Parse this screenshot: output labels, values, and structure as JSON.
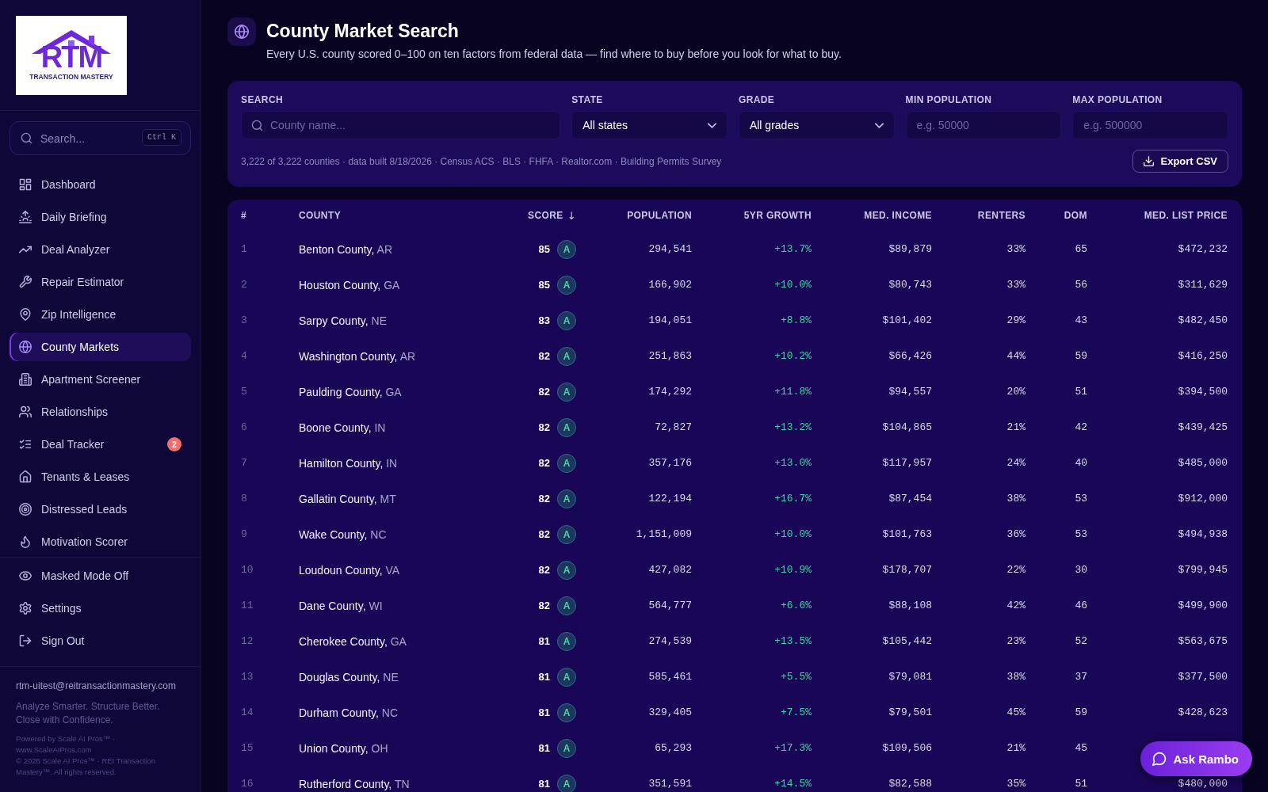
{
  "sidebar": {
    "logo": {
      "mark": "RTM",
      "name": "TRANSACTION MASTERY"
    },
    "search": {
      "placeholder": "Search...",
      "shortcut": "Ctrl K"
    },
    "nav": [
      {
        "label": "Dashboard",
        "selected": false
      },
      {
        "label": "Daily Briefing",
        "selected": false
      },
      {
        "label": "Deal Analyzer",
        "selected": false
      },
      {
        "label": "Repair Estimator",
        "selected": false
      },
      {
        "label": "Zip Intelligence",
        "selected": false
      },
      {
        "label": "County Markets",
        "selected": true
      },
      {
        "label": "Apartment Screener",
        "selected": false
      },
      {
        "label": "Relationships",
        "selected": false
      },
      {
        "label": "Deal Tracker",
        "selected": false,
        "badge": "2"
      },
      {
        "label": "Tenants & Leases",
        "selected": false
      },
      {
        "label": "Distressed Leads",
        "selected": false
      },
      {
        "label": "Motivation Scorer",
        "selected": false
      }
    ],
    "bottom_items": [
      {
        "label": "Masked Mode Off"
      },
      {
        "label": "Settings"
      },
      {
        "label": "Sign Out"
      }
    ],
    "footer": {
      "email": "rtm-uitest@reitransactionmastery.com",
      "tagline": "Analyze Smarter. Structure Better. Close with Confidence.",
      "powered": "Powered by Scale AI Pros™ · www.ScaleAIPros.com",
      "copyright": "© 2026 Scale AI Pros™ · REI Transaction Mastery™. All rights reserved."
    }
  },
  "header": {
    "title": "County Market Search",
    "subtitle": "Every U.S. county scored 0–100 on ten factors from federal data — find where to buy before you look for what to buy."
  },
  "filters": {
    "fields": [
      {
        "kind": "search",
        "label": "SEARCH",
        "placeholder": "County name..."
      },
      {
        "kind": "select",
        "label": "STATE",
        "value": "All states"
      },
      {
        "kind": "select",
        "label": "GRADE",
        "value": "All grades"
      },
      {
        "kind": "number",
        "label": "MIN POPULATION",
        "placeholder": "e.g. 50000"
      },
      {
        "kind": "number",
        "label": "MAX POPULATION",
        "placeholder": "e.g. 500000"
      }
    ],
    "summary": "3,222 of 3,222 counties · data built 8/18/2026 · Census ACS · BLS · FHFA · Realtor.com · Building Permits Survey",
    "export_button": "Export CSV"
  },
  "table": {
    "columns": [
      {
        "label": "#"
      },
      {
        "label": "COUNTY"
      },
      {
        "label": "SCORE",
        "sort_arrow": "↓"
      },
      {
        "label": "POPULATION"
      },
      {
        "label": "5YR GROWTH"
      },
      {
        "label": "MED. INCOME"
      },
      {
        "label": "RENTERS"
      },
      {
        "label": "DOM"
      },
      {
        "label": "MED. LIST PRICE"
      }
    ],
    "rows": [
      {
        "rank": "1",
        "county": "Benton County,",
        "state": "AR",
        "score": "85",
        "grade": "A",
        "population": "294,541",
        "growth": "+13.7%",
        "income": "$89,879",
        "renters": "33%",
        "dom": "65",
        "price": "$472,232"
      },
      {
        "rank": "2",
        "county": "Houston County,",
        "state": "GA",
        "score": "85",
        "grade": "A",
        "population": "166,902",
        "growth": "+10.0%",
        "income": "$80,743",
        "renters": "33%",
        "dom": "56",
        "price": "$311,629"
      },
      {
        "rank": "3",
        "county": "Sarpy County,",
        "state": "NE",
        "score": "83",
        "grade": "A",
        "population": "194,051",
        "growth": "+8.8%",
        "income": "$101,402",
        "renters": "29%",
        "dom": "43",
        "price": "$482,450"
      },
      {
        "rank": "4",
        "county": "Washington County,",
        "state": "AR",
        "score": "82",
        "grade": "A",
        "population": "251,863",
        "growth": "+10.2%",
        "income": "$66,426",
        "renters": "44%",
        "dom": "59",
        "price": "$416,250"
      },
      {
        "rank": "5",
        "county": "Paulding County,",
        "state": "GA",
        "score": "82",
        "grade": "A",
        "population": "174,292",
        "growth": "+11.8%",
        "income": "$94,557",
        "renters": "20%",
        "dom": "51",
        "price": "$394,500"
      },
      {
        "rank": "6",
        "county": "Boone County,",
        "state": "IN",
        "score": "82",
        "grade": "A",
        "population": "72,827",
        "growth": "+13.2%",
        "income": "$104,865",
        "renters": "21%",
        "dom": "42",
        "price": "$439,425"
      },
      {
        "rank": "7",
        "county": "Hamilton County,",
        "state": "IN",
        "score": "82",
        "grade": "A",
        "population": "357,176",
        "growth": "+13.0%",
        "income": "$117,957",
        "renters": "24%",
        "dom": "40",
        "price": "$485,000"
      },
      {
        "rank": "8",
        "county": "Gallatin County,",
        "state": "MT",
        "score": "82",
        "grade": "A",
        "population": "122,194",
        "growth": "+16.7%",
        "income": "$87,454",
        "renters": "38%",
        "dom": "53",
        "price": "$912,000"
      },
      {
        "rank": "9",
        "county": "Wake County,",
        "state": "NC",
        "score": "82",
        "grade": "A",
        "population": "1,151,009",
        "growth": "+10.0%",
        "income": "$101,763",
        "renters": "36%",
        "dom": "53",
        "price": "$494,938"
      },
      {
        "rank": "10",
        "county": "Loudoun County,",
        "state": "VA",
        "score": "82",
        "grade": "A",
        "population": "427,082",
        "growth": "+10.9%",
        "income": "$178,707",
        "renters": "22%",
        "dom": "30",
        "price": "$799,945"
      },
      {
        "rank": "11",
        "county": "Dane County,",
        "state": "WI",
        "score": "82",
        "grade": "A",
        "population": "564,777",
        "growth": "+6.6%",
        "income": "$88,108",
        "renters": "42%",
        "dom": "46",
        "price": "$499,900"
      },
      {
        "rank": "12",
        "county": "Cherokee County,",
        "state": "GA",
        "score": "81",
        "grade": "A",
        "population": "274,539",
        "growth": "+13.5%",
        "income": "$105,442",
        "renters": "23%",
        "dom": "52",
        "price": "$563,675"
      },
      {
        "rank": "13",
        "county": "Douglas County,",
        "state": "NE",
        "score": "81",
        "grade": "A",
        "population": "585,461",
        "growth": "+5.5%",
        "income": "$79,081",
        "renters": "38%",
        "dom": "37",
        "price": "$377,500"
      },
      {
        "rank": "14",
        "county": "Durham County,",
        "state": "NC",
        "score": "81",
        "grade": "A",
        "population": "329,405",
        "growth": "+7.5%",
        "income": "$79,501",
        "renters": "45%",
        "dom": "59",
        "price": "$428,623"
      },
      {
        "rank": "15",
        "county": "Union County,",
        "state": "OH",
        "score": "81",
        "grade": "A",
        "population": "65,293",
        "growth": "+17.3%",
        "income": "$109,506",
        "renters": "21%",
        "dom": "45"
      },
      {
        "rank": "16",
        "county": "Rutherford County,",
        "state": "TN",
        "score": "81",
        "grade": "A",
        "population": "351,591",
        "growth": "+14.5%",
        "income": "$82,588",
        "renters": "35%",
        "dom": "51",
        "price": "$480,000"
      }
    ]
  },
  "assistant_button": {
    "label": "Ask Rambo"
  }
}
